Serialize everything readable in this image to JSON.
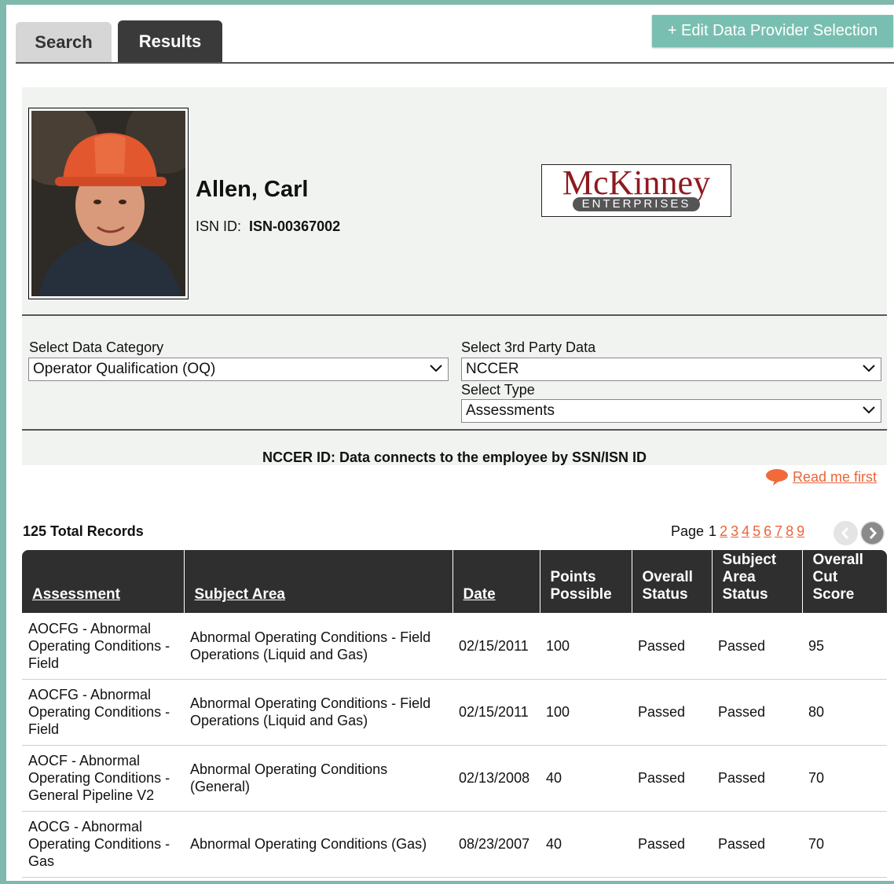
{
  "tabs": {
    "search": "Search",
    "results": "Results"
  },
  "edit_button": "+ Edit Data Provider Selection",
  "employee": {
    "name": "Allen, Carl",
    "isn_label": "ISN ID:",
    "isn_value": "ISN-00367002"
  },
  "logo": {
    "name": "McKinney",
    "sub": "ENTERPRISES"
  },
  "filters": {
    "category_label": "Select Data Category",
    "category_value": "Operator Qualification (OQ)",
    "third_party_label": "Select 3rd Party Data",
    "third_party_value": "NCCER",
    "type_label": "Select Type",
    "type_value": "Assessments"
  },
  "nccer_note": "NCCER ID: Data connects to the employee by SSN/ISN ID",
  "read_me": "Read me first",
  "total_records": "125 Total Records",
  "pager": {
    "label": "Page",
    "current": "1",
    "pages": [
      "2",
      "3",
      "4",
      "5",
      "6",
      "7",
      "8",
      "9"
    ]
  },
  "colors": {
    "accent": "#79bfb1",
    "link": "#e8653a",
    "header_bg": "#2f2f2f",
    "panel_bg": "#f1f3f1"
  },
  "table": {
    "columns": [
      "Assessment",
      "Subject Area",
      "Date",
      "Points Possible",
      "Overall Status",
      "Subject Area Status",
      "Overall Cut Score"
    ],
    "rows": [
      [
        "AOCFG - Abnormal Operating Conditions - Field",
        "Abnormal Operating Conditions - Field Operations (Liquid and Gas)",
        "02/15/2011",
        "100",
        "Passed",
        "Passed",
        "95"
      ],
      [
        "AOCFG - Abnormal Operating Conditions - Field",
        "Abnormal Operating Conditions - Field Operations (Liquid and Gas)",
        "02/15/2011",
        "100",
        "Passed",
        "Passed",
        "80"
      ],
      [
        "AOCF - Abnormal Operating Conditions - General Pipeline V2",
        "Abnormal Operating Conditions (General)",
        "02/13/2008",
        "40",
        "Passed",
        "Passed",
        "70"
      ],
      [
        "AOCG - Abnormal Operating Conditions - Gas",
        "Abnormal Operating Conditions (Gas)",
        "08/23/2007",
        "40",
        "Passed",
        "Passed",
        "70"
      ]
    ]
  }
}
